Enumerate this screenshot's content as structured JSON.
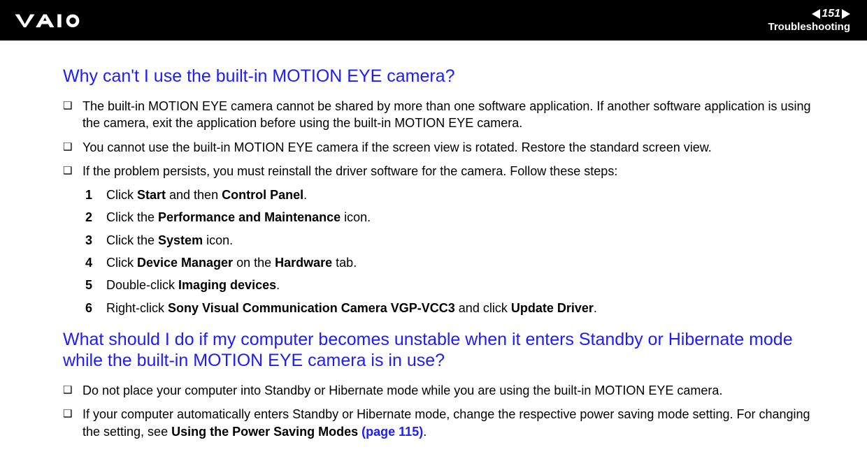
{
  "header": {
    "page_number": "151",
    "section": "Troubleshooting"
  },
  "h1": "Why can't I use the built-in MOTION EYE camera?",
  "bullets1": [
    "The built-in MOTION EYE camera cannot be shared by more than one software application. If another software application is using the camera, exit the application before using the built-in MOTION EYE camera.",
    "You cannot use the built-in MOTION EYE camera if the screen view is rotated. Restore the standard screen view.",
    "If the problem persists, you must reinstall the driver software for the camera. Follow these steps:"
  ],
  "steps": [
    {
      "n": "1",
      "pre": "Click ",
      "b1": "Start",
      "mid": " and then ",
      "b2": "Control Panel",
      "post": "."
    },
    {
      "n": "2",
      "pre": "Click the ",
      "b1": "Performance and Maintenance",
      "mid": " icon.",
      "b2": "",
      "post": ""
    },
    {
      "n": "3",
      "pre": "Click the ",
      "b1": "System",
      "mid": " icon.",
      "b2": "",
      "post": ""
    },
    {
      "n": "4",
      "pre": "Click ",
      "b1": "Device Manager",
      "mid": " on the ",
      "b2": "Hardware",
      "post": " tab."
    },
    {
      "n": "5",
      "pre": "Double-click ",
      "b1": "Imaging devices",
      "mid": ".",
      "b2": "",
      "post": ""
    },
    {
      "n": "6",
      "pre": "Right-click ",
      "b1": "Sony Visual Communication Camera VGP-VCC3",
      "mid": " and click ",
      "b2": "Update Driver",
      "post": "."
    }
  ],
  "h2": "What should I do if my computer becomes unstable when it enters Standby or Hibernate mode while the built-in MOTION EYE camera is in use?",
  "bullets2": [
    "Do not place your computer into Standby or Hibernate mode while you are using the built-in MOTION EYE camera."
  ],
  "bullet2_last": {
    "pre": "If your computer automatically enters Standby or Hibernate mode, change the respective power saving mode setting. For changing the setting, see ",
    "bold": "Using the Power Saving Modes ",
    "link": "(page 115)",
    "post": "."
  }
}
